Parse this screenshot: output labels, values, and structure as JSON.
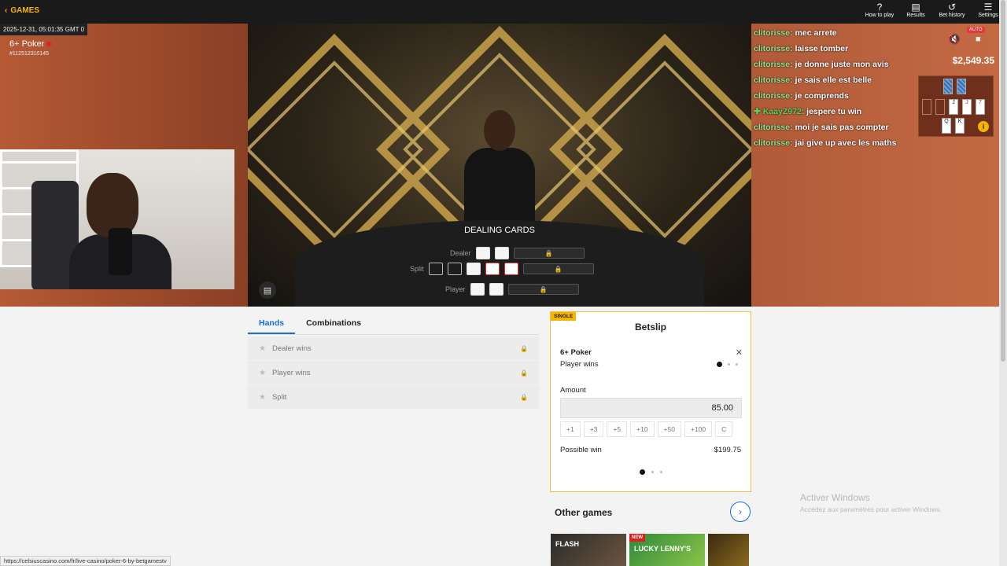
{
  "topbar": {
    "games_label": "GAMES",
    "icons": [
      {
        "label": "How to play",
        "glyph": "?"
      },
      {
        "label": "Results",
        "glyph": "▤"
      },
      {
        "label": "Bet history",
        "glyph": "↺"
      },
      {
        "label": "Settings",
        "glyph": "☰"
      }
    ]
  },
  "stage": {
    "timestamp": "2025-12-31, 05:01:35 GMT 0",
    "game_name": "6+ Poker",
    "game_id": "#112512310145",
    "status": "DEALING CARDS",
    "rows": {
      "dealer": "Dealer",
      "split": "Split",
      "player": "Player"
    },
    "balance": "$2,549.35",
    "auto_badge": "AUTO"
  },
  "chat": [
    {
      "user": "clitorisse:",
      "text": "mec arrete"
    },
    {
      "user": "clitorisse:",
      "text": "laisse tomber"
    },
    {
      "user": "clitorisse:",
      "text": "je donne juste mon avis"
    },
    {
      "user": "clitorisse:",
      "text": "je sais elle est belle"
    },
    {
      "user": "clitorisse:",
      "text": "je comprends"
    },
    {
      "user": "KaayZ972:",
      "text": "jespere tu win"
    },
    {
      "user": "clitorisse:",
      "text": "moi je sais pas compter"
    },
    {
      "user": "clitorisse:",
      "text": "jai give up avec les maths"
    }
  ],
  "mini_table": {
    "cards": [
      "J",
      "J",
      "7",
      "Q",
      "K"
    ]
  },
  "tabs": [
    "Hands",
    "Combinations"
  ],
  "hands": [
    "Dealer wins",
    "Player wins",
    "Split"
  ],
  "betslip": {
    "badge": "SINGLE",
    "title": "Betslip",
    "game": "6+ Poker",
    "pick": "Player wins",
    "amount_label": "Amount",
    "amount": "85.00",
    "quick": [
      "+1",
      "+3",
      "+5",
      "+10",
      "+50",
      "+100",
      "C"
    ],
    "possible_win_label": "Possible win",
    "possible_win": "$199.75"
  },
  "other_games": {
    "title": "Other games",
    "tiles": [
      {
        "name": "FLASH",
        "badge": ""
      },
      {
        "name": "LUCKY LENNY'S",
        "badge": "NEW"
      },
      {
        "name": "",
        "badge": ""
      }
    ]
  },
  "watermark": {
    "line1": "Activer Windows",
    "line2": "Accédez aux paramètres pour activer Windows."
  },
  "status_url": "https://celsiuscasino.com/fr/live-casino/poker-6-by-betgamestv"
}
